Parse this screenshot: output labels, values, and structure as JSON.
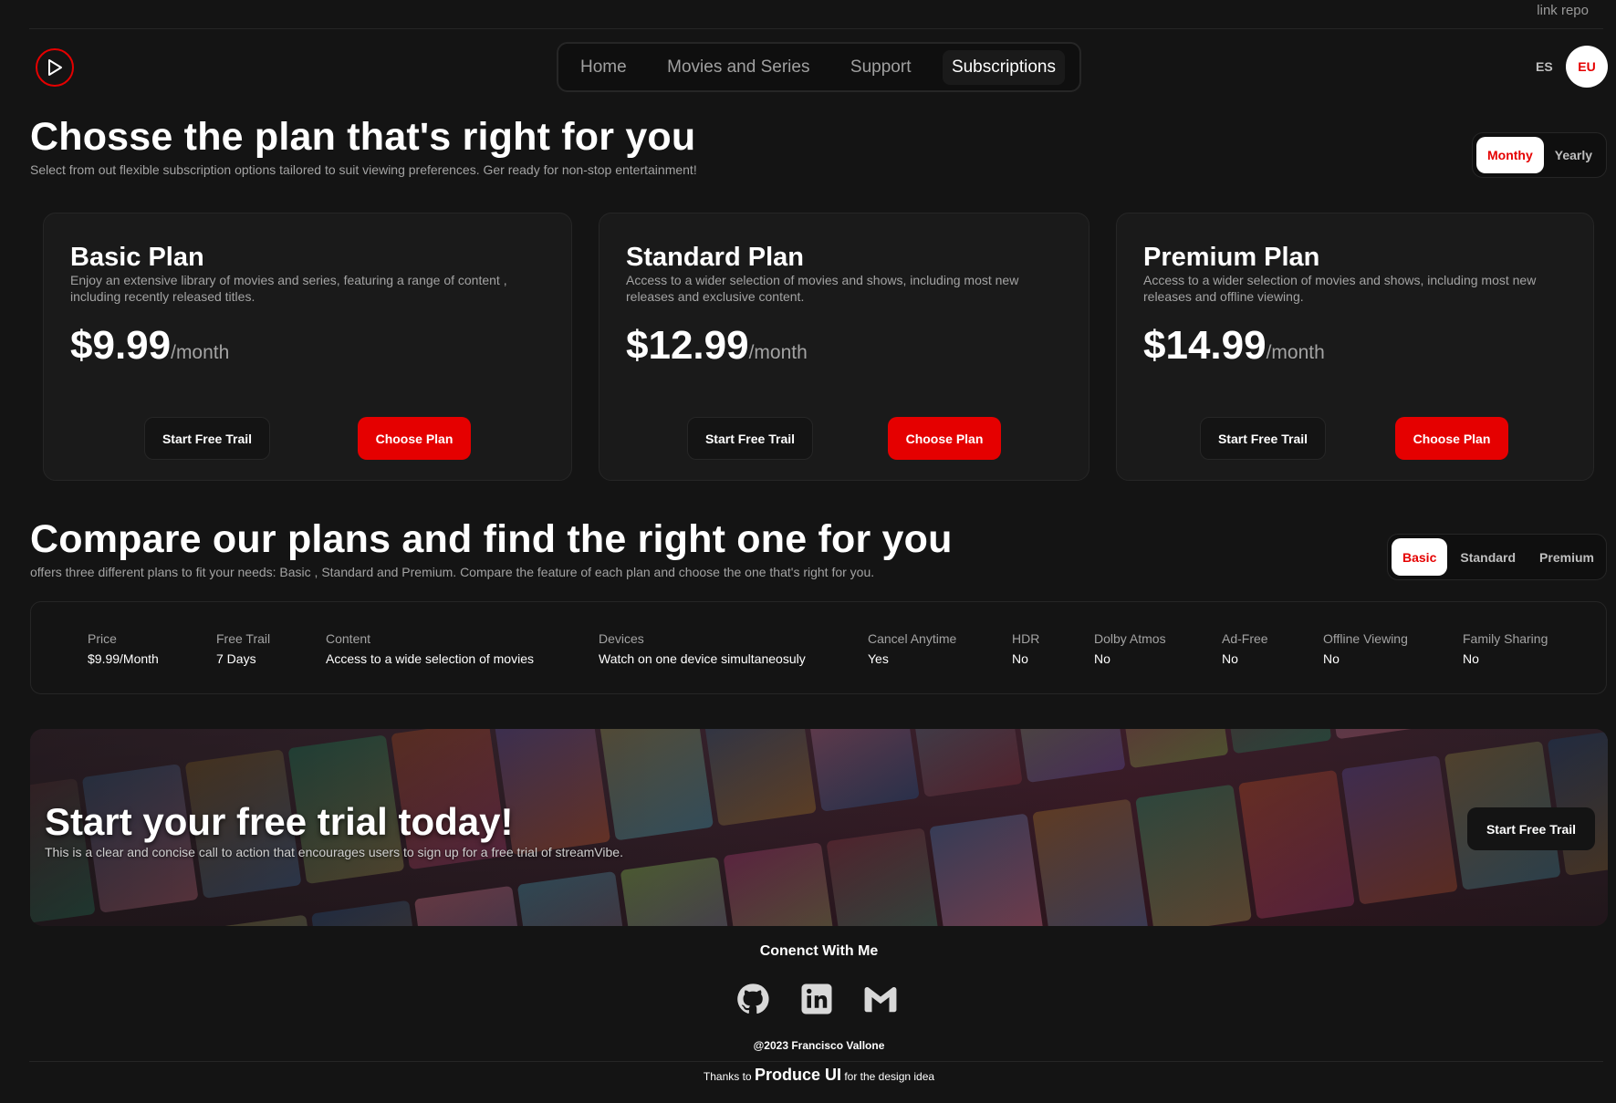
{
  "top": {
    "link_text": "link repo"
  },
  "header": {
    "nav": [
      "Home",
      "Movies and Series",
      "Support",
      "Subscriptions"
    ],
    "active_nav": "Subscriptions",
    "lang_es": "ES",
    "lang_eu": "EU"
  },
  "plans_section": {
    "title": "Chosse the plan that's right for you",
    "subtitle": "Select from out flexible subscription options tailored to suit viewing preferences. Ger ready for non-stop entertainment!",
    "billing_toggle": {
      "monthly": "Monthy",
      "yearly": "Yearly",
      "selected": "Monthy"
    }
  },
  "plans": [
    {
      "name": "Basic Plan",
      "description": "Enjoy an extensive library of movies and series, featuring a range of content , including recently released titles.",
      "price": "$9.99",
      "period": "/month",
      "trial_label": "Start Free Trail",
      "choose_label": "Choose Plan"
    },
    {
      "name": "Standard Plan",
      "description": "Access to a wider selection of movies and shows, including most new releases and exclusive content.",
      "price": "$12.99",
      "period": "/month",
      "trial_label": "Start Free Trail",
      "choose_label": "Choose Plan"
    },
    {
      "name": "Premium Plan",
      "description": "Access to a wider selection of movies and shows, including most new releases and offline viewing.",
      "price": "$14.99",
      "period": "/month",
      "trial_label": "Start Free Trail",
      "choose_label": "Choose Plan"
    }
  ],
  "compare_section": {
    "title": "Compare our plans and find the right one for you",
    "subtitle": "offers three different plans to fit your needs: Basic , Standard and Premium. Compare the feature of each plan and choose the one that's right for you.",
    "plan_toggle": {
      "basic": "Basic",
      "standard": "Standard",
      "premium": "Premium",
      "selected": "Basic"
    },
    "features": [
      {
        "label": "Price",
        "value": "$9.99/Month"
      },
      {
        "label": "Free Trail",
        "value": "7 Days"
      },
      {
        "label": "Content",
        "value": "Access to a wide selection of movies"
      },
      {
        "label": "Devices",
        "value": "Watch on one device simultaneosuly"
      },
      {
        "label": "Cancel Anytime",
        "value": "Yes"
      },
      {
        "label": "HDR",
        "value": "No"
      },
      {
        "label": "Dolby Atmos",
        "value": "No"
      },
      {
        "label": "Ad-Free",
        "value": "No"
      },
      {
        "label": "Offline Viewing",
        "value": "No"
      },
      {
        "label": "Family Sharing",
        "value": "No"
      }
    ]
  },
  "banner": {
    "title": "Start your free trial today!",
    "subtitle": "This is a clear and concise call to action that encourages users to sign up for a free trial of streamVibe.",
    "button": "Start Free Trail"
  },
  "footer": {
    "connect": "Conenct With Me",
    "icons": [
      "github-icon",
      "linkedin-icon",
      "gmail-icon"
    ],
    "copyright": "@2023 Francisco Vallone",
    "thanks_pre": "Thanks to",
    "thanks_brand": "Produce UI",
    "thanks_post": "for the design idea"
  },
  "colors": {
    "accent": "#e50000",
    "background": "#141414",
    "card": "#1a1a1a",
    "border": "#262626"
  }
}
